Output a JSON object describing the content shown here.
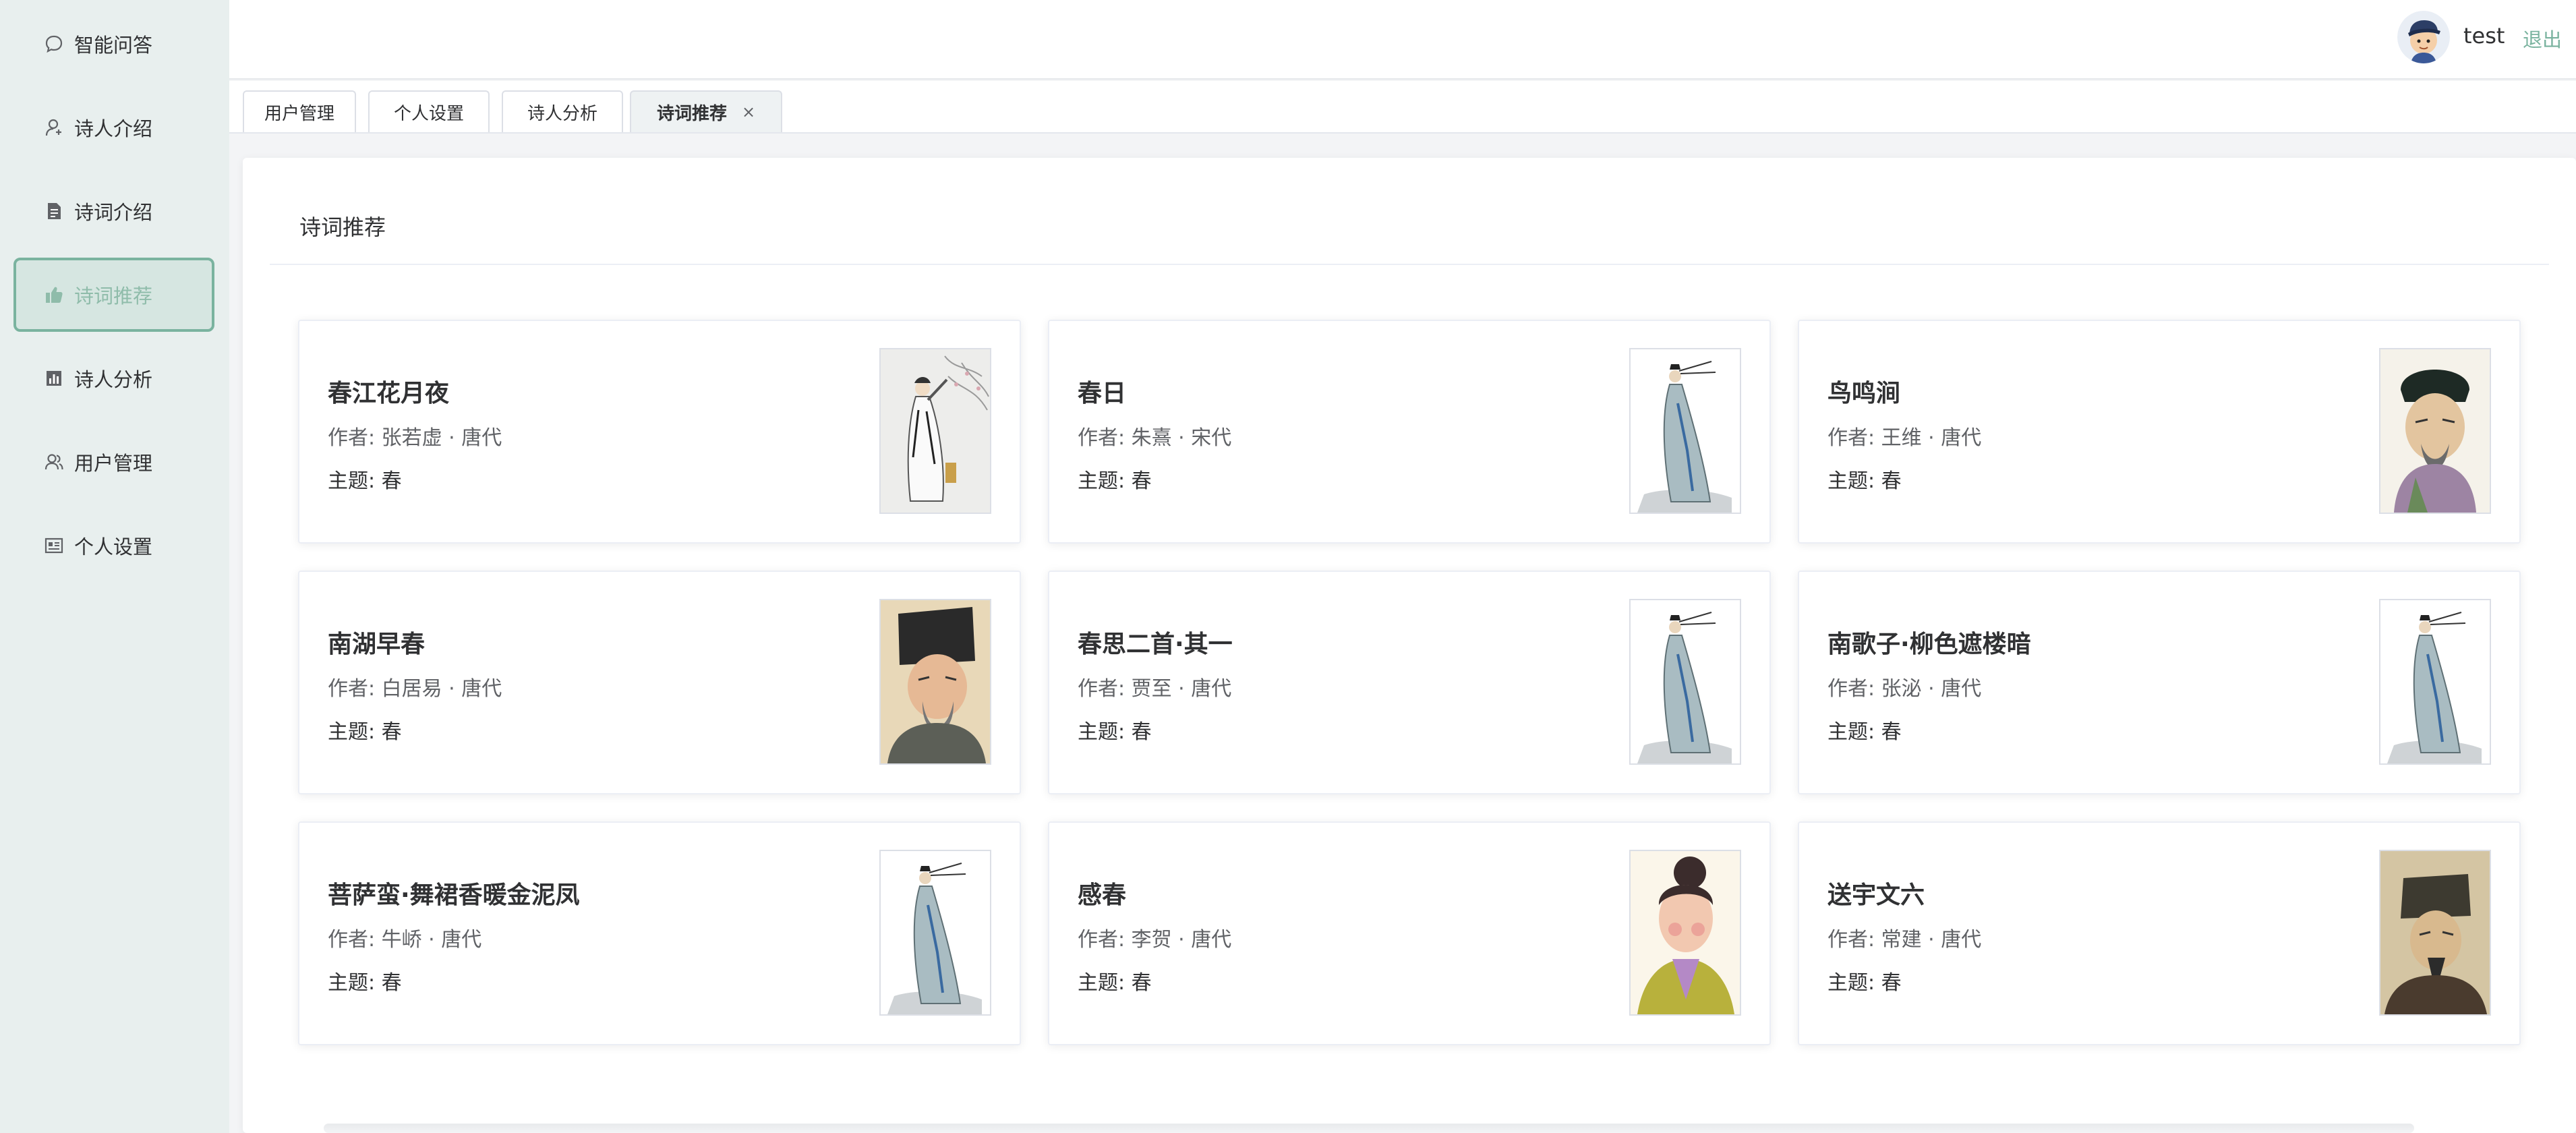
{
  "sidebar": {
    "items": [
      {
        "label": "智能问答",
        "icon": "chat-bubble-icon"
      },
      {
        "label": "诗人介绍",
        "icon": "user-icon"
      },
      {
        "label": "诗词介绍",
        "icon": "document-icon"
      },
      {
        "label": "诗词推荐",
        "icon": "thumbs-up-icon",
        "active": true
      },
      {
        "label": "诗人分析",
        "icon": "bar-chart-icon"
      },
      {
        "label": "用户管理",
        "icon": "users-icon"
      },
      {
        "label": "个人设置",
        "icon": "id-card-icon"
      }
    ]
  },
  "header": {
    "username": "test",
    "logout_label": "退出"
  },
  "tabs": [
    {
      "label": "用户管理"
    },
    {
      "label": "个人设置"
    },
    {
      "label": "诗人分析"
    },
    {
      "label": "诗词推荐",
      "active": true,
      "close": "×"
    }
  ],
  "main": {
    "title": "诗词推荐",
    "poems": [
      {
        "title": "春江花月夜",
        "author": "作者: 张若虚 · 唐代",
        "theme": "主题:  春",
        "image": "poet-white-robe-blossom"
      },
      {
        "title": "春日",
        "author": "作者: 朱熹 · 宋代",
        "theme": "主题:  春",
        "image": "poet-blue-robe"
      },
      {
        "title": "鸟鸣涧",
        "author": "作者: 王维 · 唐代",
        "theme": "主题:  春",
        "image": "poet-portrait-hat"
      },
      {
        "title": "南湖早春",
        "author": "作者: 白居易 · 唐代",
        "theme": "主题:  春",
        "image": "poet-portrait-black-hat"
      },
      {
        "title": "春思二首·其一",
        "author": "作者: 贾至 · 唐代",
        "theme": "主题:  春",
        "image": "poet-blue-robe"
      },
      {
        "title": "南歌子·柳色遮楼暗",
        "author": "作者: 张泌 · 唐代",
        "theme": "主题:  春",
        "image": "poet-blue-robe"
      },
      {
        "title": "菩萨蛮·舞裙香暖金泥凤",
        "author": "作者: 牛峤 · 唐代",
        "theme": "主题:  春",
        "image": "poet-blue-robe"
      },
      {
        "title": "感春",
        "author": "作者: 李贺 · 唐代",
        "theme": "主题:  春",
        "image": "poet-portrait-green-robe"
      },
      {
        "title": "送宇文六",
        "author": "作者: 常建 · 唐代",
        "theme": "主题:  春",
        "image": "poet-portrait-dark"
      }
    ]
  },
  "colors": {
    "accent": "#7ab39f",
    "sidebar_bg": "#e8efee",
    "active_bg": "#d6e6e1"
  }
}
